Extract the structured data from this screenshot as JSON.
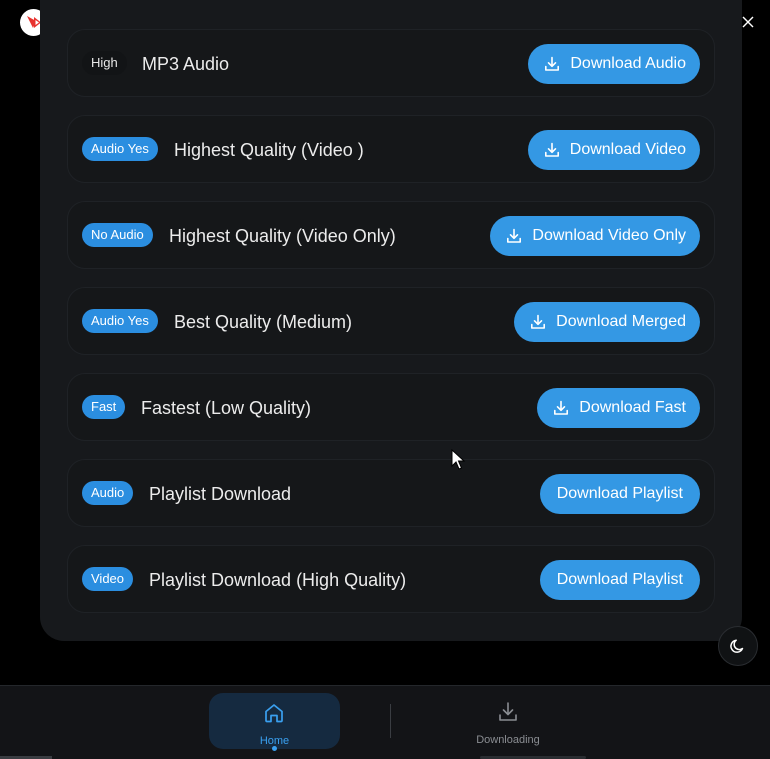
{
  "window": {
    "controls": {
      "minimize_icon": "minimize-icon",
      "maximize_icon": "maximize-icon",
      "close_icon": "close-icon"
    }
  },
  "colors": {
    "accent": "#3498e4",
    "badge": "#2b8ee0",
    "card": "#17191c",
    "nav_active": "#152a40"
  },
  "options": [
    {
      "badge": "High",
      "label": "MP3 Audio",
      "button": "Download Audio",
      "icon": "download-icon"
    },
    {
      "badge": "Audio Yes",
      "label": "Highest Quality (Video )",
      "button": "Download Video",
      "icon": "download-icon"
    },
    {
      "badge": "No Audio",
      "label": "Highest Quality (Video Only)",
      "button": "Download Video Only",
      "icon": "download-icon"
    },
    {
      "badge": "Audio Yes",
      "label": "Best Quality (Medium)",
      "button": "Download Merged",
      "icon": "download-icon"
    },
    {
      "badge": "Fast",
      "label": "Fastest (Low Quality)",
      "button": "Download Fast",
      "icon": "download-icon"
    },
    {
      "badge": "Audio",
      "label": "Playlist Download",
      "button": "Download Playlist",
      "icon": ""
    },
    {
      "badge": "Video",
      "label": "Playlist Download (High Quality)",
      "button": "Download Playlist",
      "icon": ""
    }
  ],
  "nav": {
    "home": {
      "label": "Home",
      "icon": "home-icon"
    },
    "downloading": {
      "label": "Downloading",
      "icon": "download-tray-icon"
    }
  },
  "theme_toggle": {
    "icon": "moon-icon"
  }
}
